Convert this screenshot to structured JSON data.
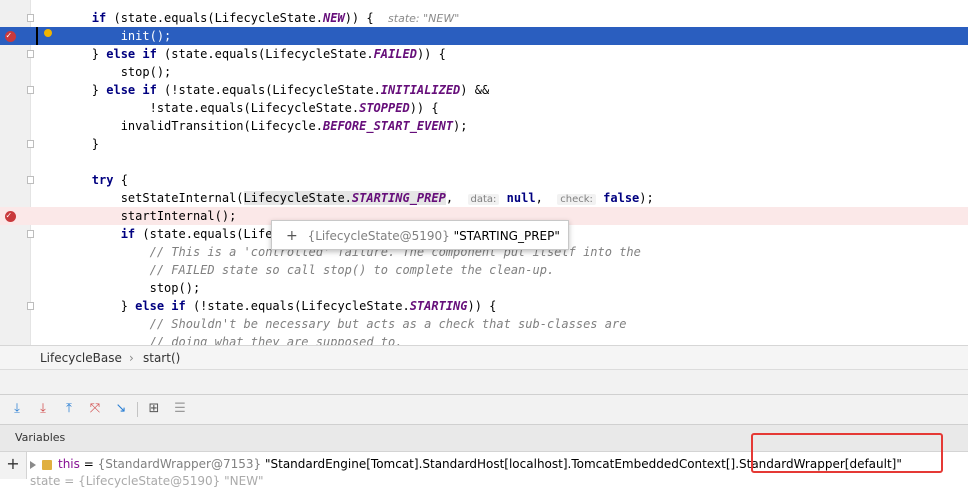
{
  "editor": {
    "lines": [
      {
        "type": "fold",
        "indent": "        ",
        "parts": [
          [
            "kw",
            "if"
          ],
          [
            "",
            " (state.equals(LifecycleState."
          ],
          [
            "const",
            "NEW"
          ],
          [
            "",
            ")) {  "
          ],
          [
            "inlay",
            "state: \"NEW\""
          ]
        ]
      },
      {
        "type": "exec",
        "indent": "            ",
        "parts": [
          [
            "",
            "init();"
          ]
        ]
      },
      {
        "type": "fold",
        "indent": "        ",
        "parts": [
          [
            "",
            "} "
          ],
          [
            "kw",
            "else if"
          ],
          [
            "",
            " (state.equals(LifecycleState."
          ],
          [
            "const",
            "FAILED"
          ],
          [
            "",
            ")) {"
          ]
        ]
      },
      {
        "type": "plain",
        "indent": "            ",
        "parts": [
          [
            "",
            "stop();"
          ]
        ]
      },
      {
        "type": "fold",
        "indent": "        ",
        "parts": [
          [
            "",
            "} "
          ],
          [
            "kw",
            "else if"
          ],
          [
            "",
            " (!state.equals(LifecycleState."
          ],
          [
            "const",
            "INITIALIZED"
          ],
          [
            "",
            ") &&"
          ]
        ]
      },
      {
        "type": "plain",
        "indent": "                ",
        "parts": [
          [
            "",
            "!state.equals(LifecycleState."
          ],
          [
            "const",
            "STOPPED"
          ],
          [
            "",
            ")) {"
          ]
        ]
      },
      {
        "type": "plain",
        "indent": "            ",
        "parts": [
          [
            "",
            "invalidTransition(Lifecycle."
          ],
          [
            "const",
            "BEFORE_START_EVENT"
          ],
          [
            "",
            ");"
          ]
        ]
      },
      {
        "type": "fold",
        "indent": "        ",
        "parts": [
          [
            "",
            "}"
          ]
        ]
      },
      {
        "type": "plain",
        "indent": "",
        "parts": []
      },
      {
        "type": "fold",
        "indent": "        ",
        "parts": [
          [
            "kw",
            "try"
          ],
          [
            "",
            " {"
          ]
        ]
      },
      {
        "type": "plain",
        "indent": "            ",
        "parts": [
          [
            "",
            "setStateInternal("
          ],
          [
            "hl",
            "LifecycleState."
          ],
          [
            "const hl",
            "STARTING_PREP"
          ],
          [
            "",
            ",  "
          ],
          [
            "hint",
            "data:"
          ],
          [
            "",
            " "
          ],
          [
            "kw",
            "null"
          ],
          [
            "",
            ",  "
          ],
          [
            "hint",
            "check:"
          ],
          [
            "",
            " "
          ],
          [
            "kw",
            "false"
          ],
          [
            "",
            ");"
          ]
        ]
      },
      {
        "type": "bp",
        "indent": "            ",
        "parts": [
          [
            "",
            "startInternal();"
          ]
        ]
      },
      {
        "type": "fold",
        "indent": "            ",
        "parts": [
          [
            "kw",
            "if"
          ],
          [
            "",
            " (state.equals(Lifec"
          ]
        ]
      },
      {
        "type": "plain",
        "indent": "                ",
        "parts": [
          [
            "cm",
            "// This is a 'controlled' failure. The component put itself into the"
          ]
        ]
      },
      {
        "type": "plain",
        "indent": "                ",
        "parts": [
          [
            "cm",
            "// FAILED state so call stop() to complete the clean-up."
          ]
        ]
      },
      {
        "type": "plain",
        "indent": "                ",
        "parts": [
          [
            "",
            "stop();"
          ]
        ]
      },
      {
        "type": "fold",
        "indent": "            ",
        "parts": [
          [
            "",
            "} "
          ],
          [
            "kw",
            "else if"
          ],
          [
            "",
            " (!state.equals(LifecycleState."
          ],
          [
            "const",
            "STARTING"
          ],
          [
            "",
            ")) {"
          ]
        ]
      },
      {
        "type": "plain",
        "indent": "                ",
        "parts": [
          [
            "cm",
            "// Shouldn't be necessary but acts as a check that sub-classes are"
          ]
        ]
      },
      {
        "type": "plain",
        "indent": "                ",
        "parts": [
          [
            "cm",
            "// doing what they are supposed to."
          ]
        ]
      }
    ]
  },
  "tooltip": {
    "expand_icon": "+",
    "object": "{LifecycleState@5190}",
    "value": "\"STARTING_PREP\""
  },
  "breadcrumb": {
    "class_name": "LifecycleBase",
    "separator": "›",
    "method": "start()"
  },
  "debug_toolbar": {
    "buttons": [
      {
        "name": "step-over-icon",
        "glyph": "⤓",
        "color": "#2a7fd4"
      },
      {
        "name": "step-into-icon",
        "glyph": "⤓",
        "color": "#d14b4b"
      },
      {
        "name": "step-out-icon",
        "glyph": "⤒",
        "color": "#2a7fd4"
      },
      {
        "name": "drop-frame-icon",
        "glyph": "⤧",
        "color": "#d14b4b"
      },
      {
        "name": "run-to-cursor-icon",
        "glyph": "↘",
        "color": "#2a7fd4"
      },
      {
        "name": "evaluate-expression-icon",
        "glyph": "⊞",
        "color": "#555555"
      },
      {
        "name": "trace-stream-icon",
        "glyph": "☰",
        "color": "#9a9a9a"
      }
    ]
  },
  "variables": {
    "tab_label": "Variables",
    "add_icon": "+",
    "rows": [
      {
        "name": "this",
        "equals": " = ",
        "type": "{StandardWrapper@7153}",
        "value": " \"StandardEngine[Tomcat].StandardHost[localhost].TomcatEmbeddedContext[].StandardWrapper[default]\""
      }
    ],
    "partial_next": "state = {LifecycleState@5190} \"NEW\""
  },
  "colors": {
    "execution_line": "#2a5ebf",
    "breakpoint": "#c9393c",
    "highlight_box": "#e53935"
  }
}
